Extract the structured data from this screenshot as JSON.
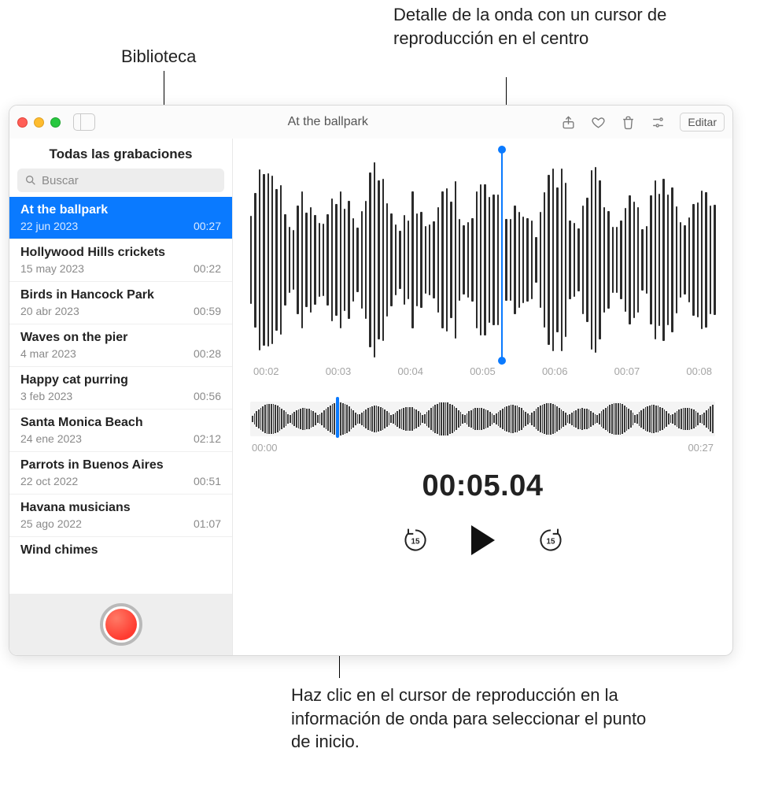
{
  "callouts": {
    "top_left": "Biblioteca",
    "top_right": "Detalle de la onda con un cursor de reproducción en el centro",
    "bottom": "Haz clic en el cursor de reproducción en la información de onda para seleccionar el punto de inicio."
  },
  "window": {
    "title": "At the ballpark",
    "edit_label": "Editar"
  },
  "sidebar": {
    "header": "Todas las grabaciones",
    "search_placeholder": "Buscar",
    "items": [
      {
        "name": "At the ballpark",
        "date": "22 jun 2023",
        "duration": "00:27",
        "selected": true
      },
      {
        "name": "Hollywood Hills crickets",
        "date": "15 may 2023",
        "duration": "00:22"
      },
      {
        "name": "Birds in Hancock Park",
        "date": "20 abr 2023",
        "duration": "00:59"
      },
      {
        "name": "Waves on the pier",
        "date": "4 mar 2023",
        "duration": "00:28"
      },
      {
        "name": "Happy cat purring",
        "date": "3 feb 2023",
        "duration": "00:56"
      },
      {
        "name": "Santa Monica Beach",
        "date": "24 ene 2023",
        "duration": "02:12"
      },
      {
        "name": "Parrots in Buenos Aires",
        "date": "22 oct 2022",
        "duration": "00:51"
      },
      {
        "name": "Havana musicians",
        "date": "25 ago 2022",
        "duration": "01:07"
      },
      {
        "name": "Wind chimes",
        "date": "",
        "duration": ""
      }
    ]
  },
  "detail": {
    "timescale": [
      "00:02",
      "00:03",
      "00:04",
      "00:05",
      "00:06",
      "00:07",
      "00:08"
    ],
    "playhead_percent": 54
  },
  "overview": {
    "start": "00:00",
    "end": "00:27",
    "playhead_percent": 18.5
  },
  "timecode": "00:05.04",
  "skip_seconds": "15"
}
